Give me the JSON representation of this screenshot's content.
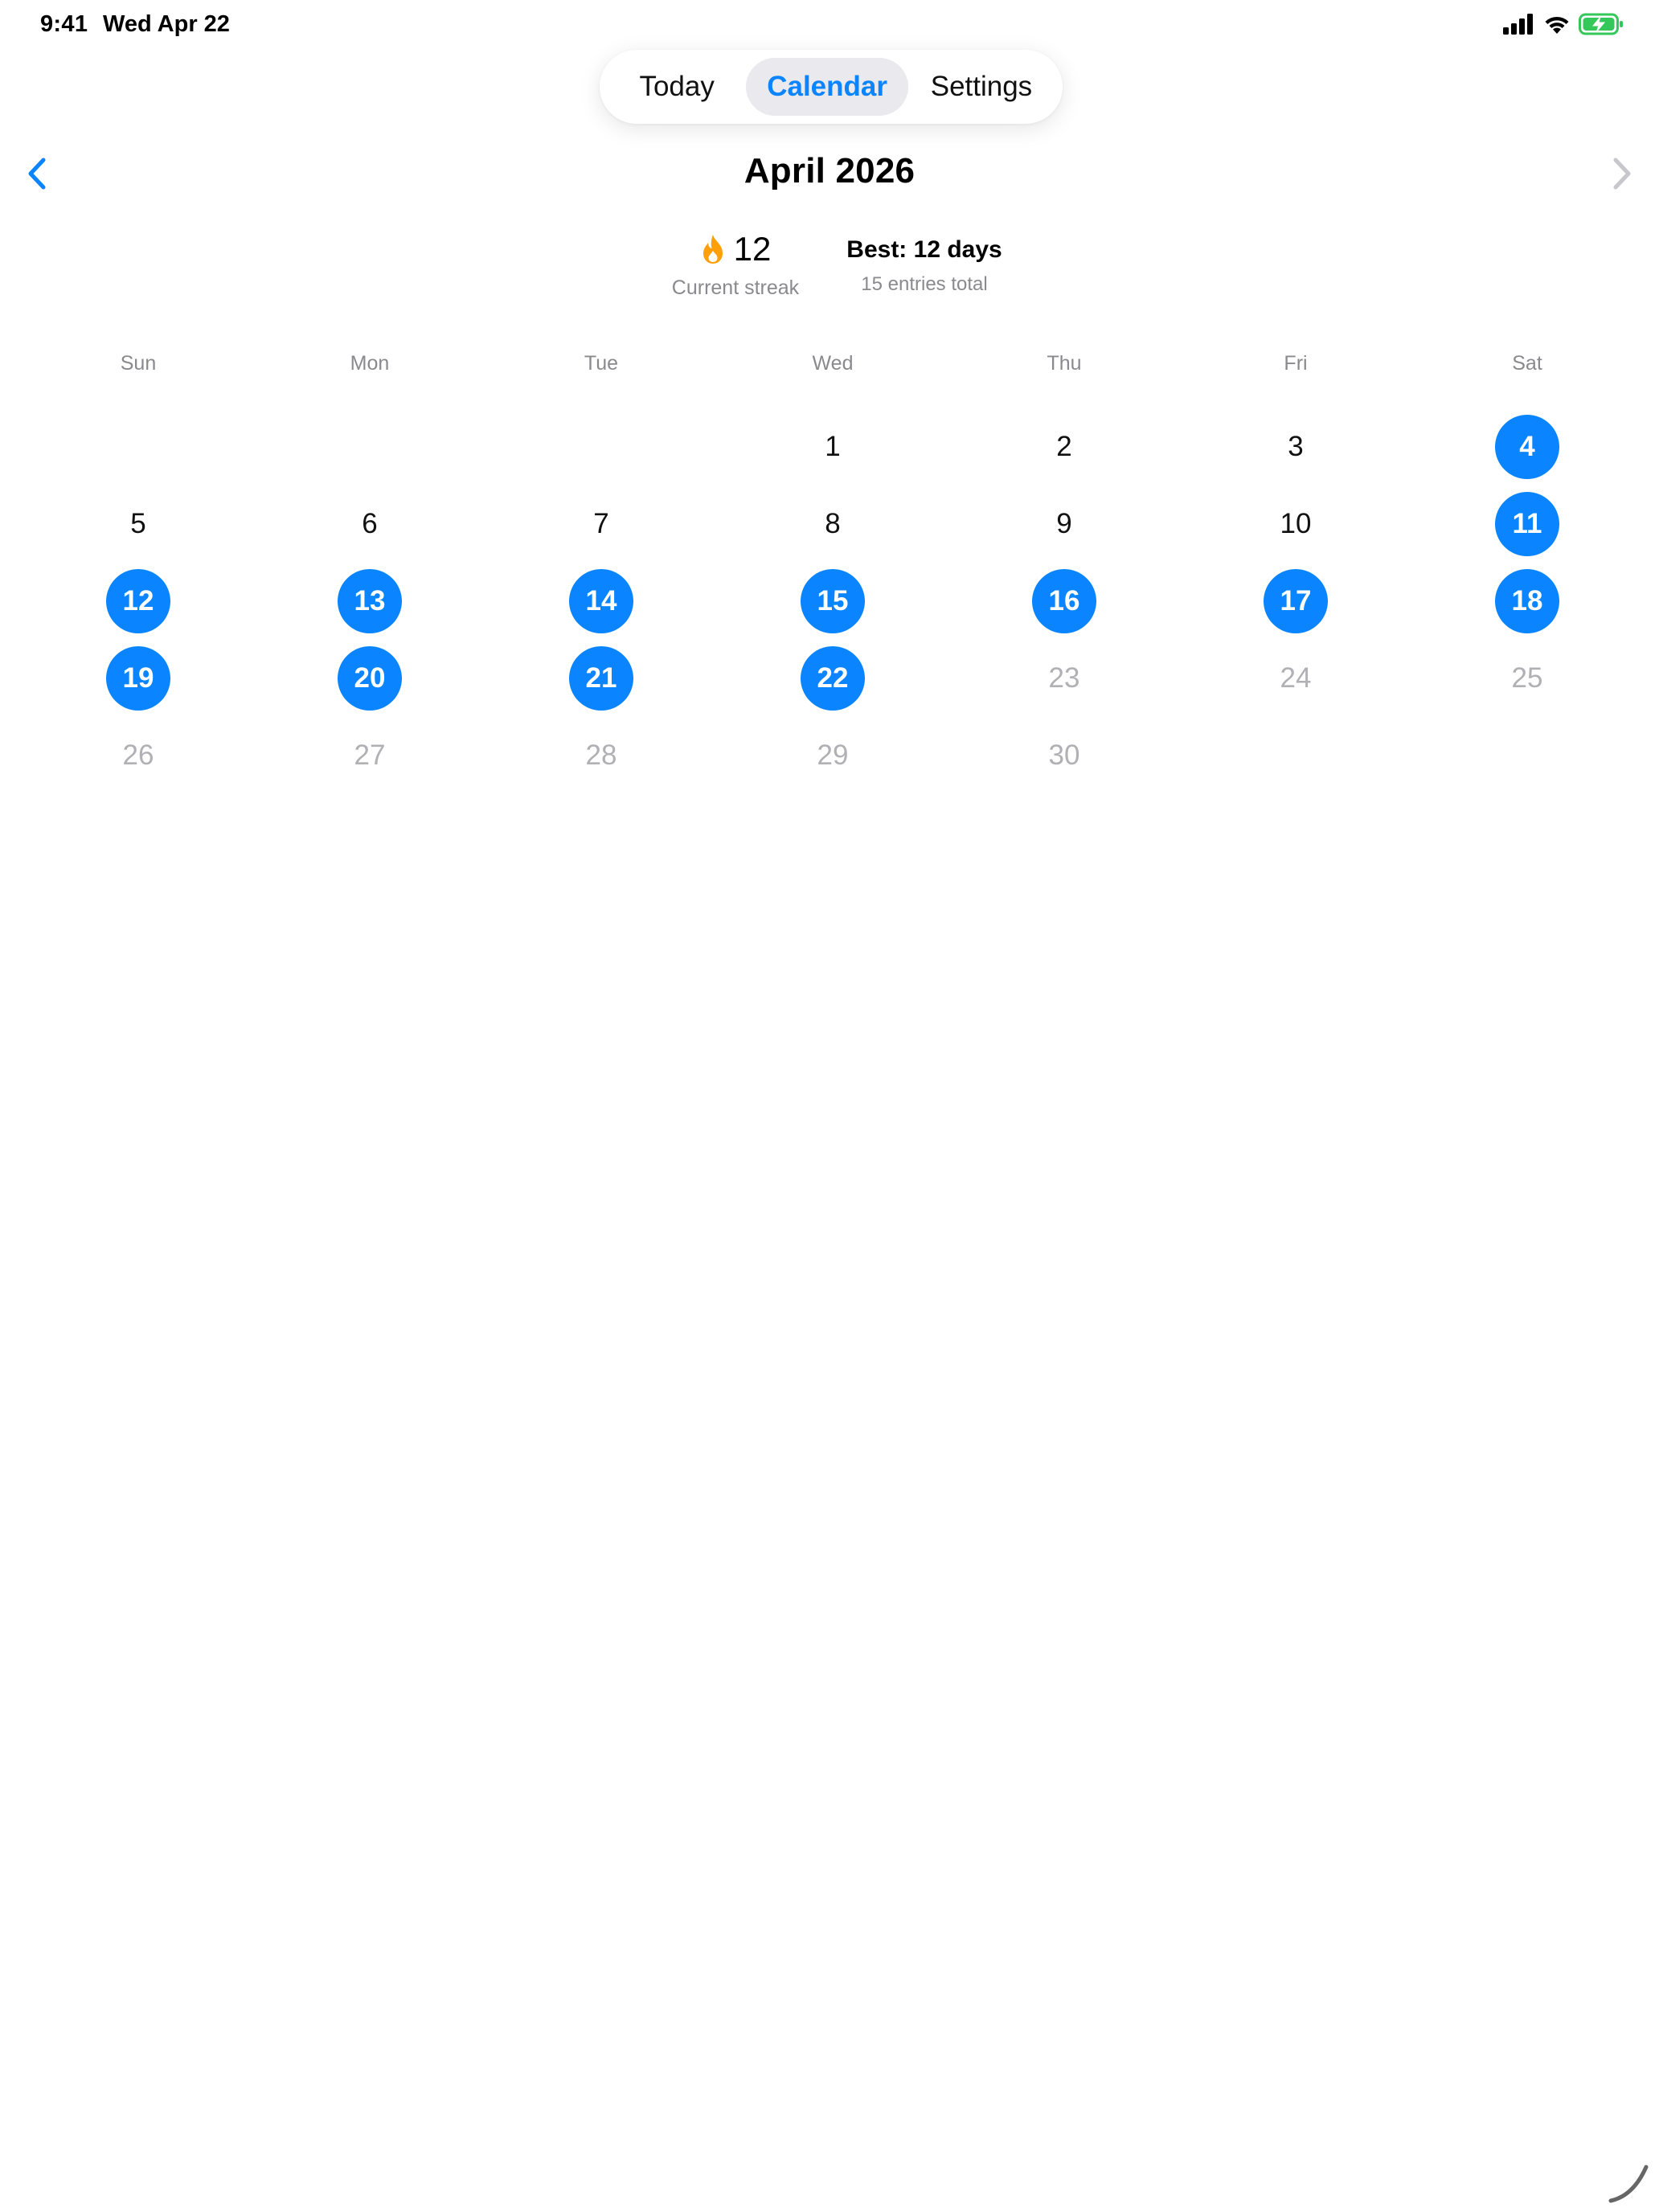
{
  "status_bar": {
    "time": "9:41",
    "date": "Wed Apr 22",
    "icons": [
      "cellular-signal-icon",
      "wifi-icon",
      "battery-charging-icon"
    ],
    "battery_color": "#34c759"
  },
  "tabs": [
    {
      "label": "Today",
      "selected": false
    },
    {
      "label": "Calendar",
      "selected": true
    },
    {
      "label": "Settings",
      "selected": false
    }
  ],
  "header": {
    "month_title": "April 2026",
    "prev_icon": "chevron-left-icon",
    "next_icon": "chevron-right-icon",
    "next_enabled": false
  },
  "streak": {
    "icon": "flame-icon",
    "value": "12",
    "label": "Current streak",
    "best": "Best: 12 days",
    "total": "15 entries total"
  },
  "calendar": {
    "weekdays": [
      "Sun",
      "Mon",
      "Tue",
      "Wed",
      "Thu",
      "Fri",
      "Sat"
    ],
    "first_weekday_index": 3,
    "days_in_month": 30,
    "today": 22,
    "entry_days": [
      4,
      11,
      12,
      13,
      14,
      15,
      16,
      17,
      18,
      19,
      20,
      21,
      22
    ]
  },
  "colors": {
    "accent": "#0a84ff",
    "streak_flame": "#ff9f0a",
    "secondary_text": "#8a8a8e",
    "disabled_text": "#b0b0b5"
  }
}
